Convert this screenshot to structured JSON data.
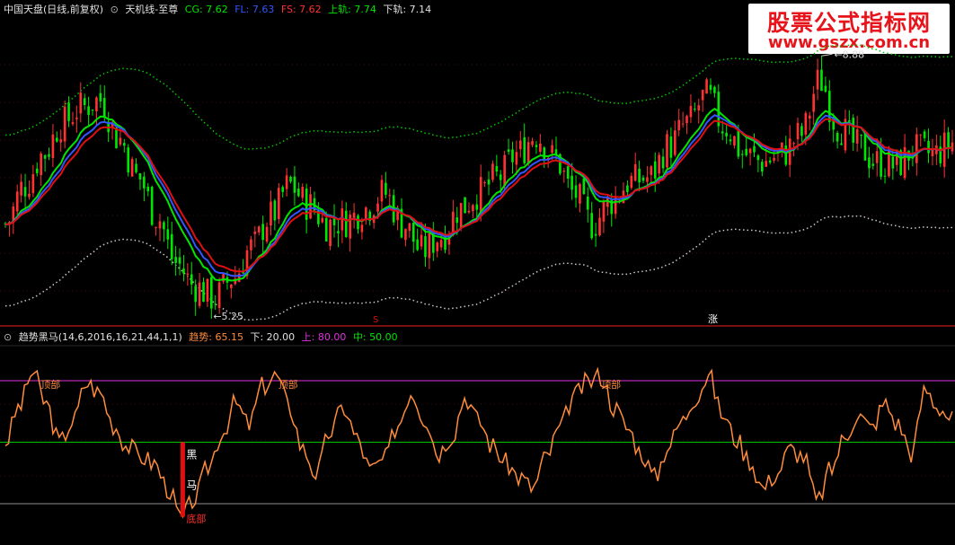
{
  "main_header": {
    "symbol": "中国天盘(日线,前复权)",
    "indicator": "天机线-至尊",
    "cg": "CG: 7.62",
    "fl": "FL: 7.63",
    "fs": "FS: 7.62",
    "upper": "上轨: 7.74",
    "lower": "下轨: 7.14"
  },
  "sub_header": {
    "name": "趋势黑马(14,6,2016,16,21,44,1,1)",
    "trend": "趋势: 65.15",
    "down": "下: 20.00",
    "up": "上: 80.00",
    "mid": "中: 50.00"
  },
  "watermark": {
    "line1": "股票公式指标网",
    "line2": "www.gszx.com.cn"
  },
  "colors": {
    "up_candle": "#ff3232",
    "down_candle": "#00e600",
    "cg": "#00e600",
    "fl": "#3355ff",
    "fs": "#e01010",
    "upper_band": "#00c800",
    "lower_band": "#c8c8c8",
    "oscillator": "#ff8c3c",
    "level_up": "#e030e0",
    "level_mid": "#00c800",
    "level_down": "#909090",
    "divider": "#c01818"
  },
  "chart_data": [
    {
      "type": "candlestick",
      "annotations": [
        {
          "text": "8.88",
          "kind": "high"
        },
        {
          "text": "5.25",
          "kind": "low"
        },
        {
          "text": "S",
          "kind": "marker"
        },
        {
          "text": "涨",
          "kind": "marker"
        }
      ],
      "series": [
        {
          "name": "CG",
          "last": 7.62
        },
        {
          "name": "FL",
          "last": 7.63
        },
        {
          "name": "FS",
          "last": 7.62
        },
        {
          "name": "上轨",
          "last": 7.74
        },
        {
          "name": "下轨",
          "last": 7.14
        }
      ],
      "ylim": [
        5.0,
        9.0
      ],
      "price_path": [
        6.3,
        6.8,
        7.2,
        7.6,
        7.8,
        7.9,
        7.4,
        6.9,
        6.4,
        5.8,
        5.5,
        5.35,
        5.6,
        6.0,
        6.4,
        6.8,
        6.55,
        6.3,
        6.35,
        6.5,
        6.7,
        6.3,
        5.95,
        6.15,
        6.5,
        6.7,
        6.9,
        7.2,
        7.45,
        7.15,
        6.7,
        6.3,
        6.6,
        6.85,
        6.9,
        7.3,
        7.6,
        7.95,
        7.55,
        7.2,
        7.1,
        7.2,
        7.45,
        8.15,
        7.55,
        7.3,
        7.1,
        7.05,
        7.25,
        7.2,
        7.35
      ]
    },
    {
      "type": "line",
      "title": "趋势黑马",
      "ylim": [
        0,
        100
      ],
      "levels": {
        "上": 80,
        "中": 50,
        "下": 20
      },
      "last": 65.15,
      "annotations": [
        {
          "text": "顶部"
        },
        {
          "text": "顶部"
        },
        {
          "text": "顶部"
        },
        {
          "text": "黑"
        },
        {
          "text": "马"
        },
        {
          "text": "底部"
        }
      ],
      "values": [
        50,
        70,
        90,
        72,
        50,
        62,
        84,
        78,
        60,
        48,
        42,
        38,
        24,
        6,
        18,
        36,
        55,
        72,
        60,
        82,
        88,
        70,
        46,
        32,
        56,
        70,
        52,
        34,
        40,
        60,
        79,
        64,
        44,
        54,
        76,
        62,
        48,
        38,
        30,
        24,
        42,
        58,
        76,
        84,
        88,
        70,
        58,
        44,
        30,
        48,
        62,
        76,
        88,
        66,
        52,
        40,
        24,
        32,
        46,
        42,
        16,
        34,
        52,
        66,
        58,
        72,
        60,
        44,
        80,
        70,
        63
      ]
    }
  ]
}
